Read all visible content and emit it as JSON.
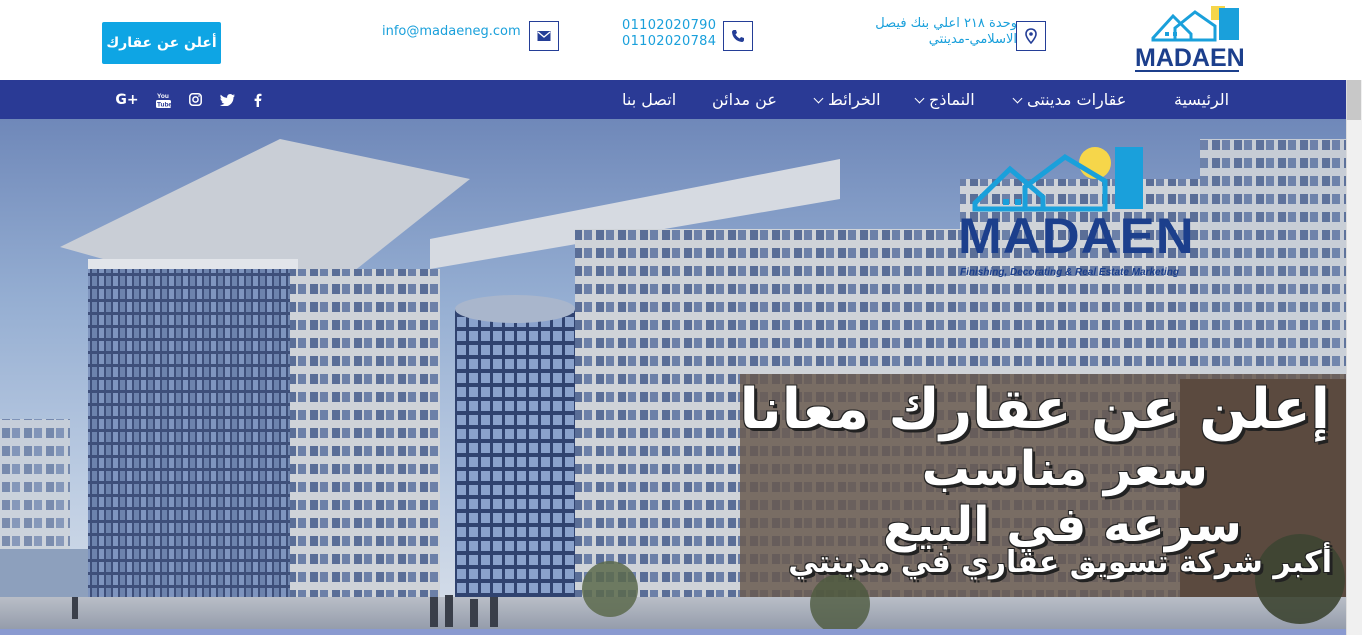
{
  "header": {
    "logo_text": "MADAEN",
    "address": "وحدة ٢١٨ اعلي بنك فيصل الاسلامي-مدينتي",
    "phone_1": "01102020790",
    "phone_2": "01102020784",
    "email": "info@madaeneg.com",
    "cta_label": "أعلن عن عقارك",
    "icons": [
      "map-marker-icon",
      "phone-icon",
      "envelope-icon"
    ]
  },
  "nav": {
    "items": [
      {
        "label": "الرئيسية",
        "has_dropdown": false
      },
      {
        "label": "عقارات مدينتى",
        "has_dropdown": true
      },
      {
        "label": "النماذج",
        "has_dropdown": true
      },
      {
        "label": "الخرائط",
        "has_dropdown": true
      },
      {
        "label": "عن مدائن",
        "has_dropdown": false
      },
      {
        "label": "اتصل بنا",
        "has_dropdown": false
      }
    ],
    "social": [
      "facebook-icon",
      "twitter-icon",
      "instagram-icon",
      "youtube-icon",
      "google-plus-icon"
    ],
    "google_plus_label": "G+",
    "youtube_label": "You\nTube"
  },
  "hero": {
    "logo_text": "MADAEN",
    "logo_tagline": "Finishing, Decorating & Real Estate Marketing",
    "line_1": "إعلن عن عقارك معانا",
    "line_2": "سعر مناسب",
    "line_3": "سرعه في البيع",
    "line_4": "أكبر شركة تسويق عقاري في مدينتي"
  },
  "colors": {
    "nav_bg": "#2a3a95",
    "accent": "#0ea5e4",
    "link": "#1aa0db",
    "brand_blue": "#243e97"
  }
}
